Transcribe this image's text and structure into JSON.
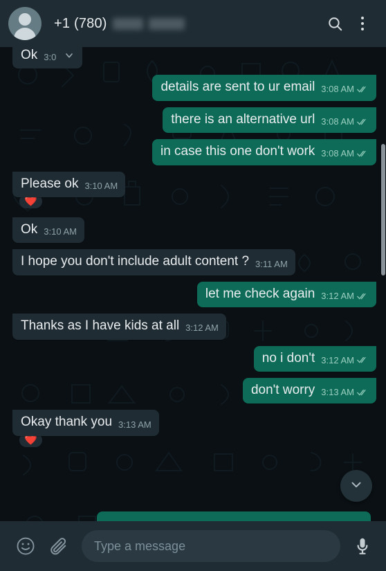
{
  "app": {
    "name": "WhatsApp",
    "theme": "dark"
  },
  "colors": {
    "header_bg": "#1f2c33",
    "chat_bg": "#0a1014",
    "incoming_bubble": "#202c33",
    "outgoing_bubble": "#0d6b57",
    "text_primary": "#e9edef",
    "timestamp": "#8fa3ab",
    "tick_blue": "#86c3b2",
    "input_bg": "#2a3942"
  },
  "header": {
    "contact_name": "+1 (780)",
    "name_redacted": true,
    "avatar": "default-person-avatar",
    "search_icon": "search-icon",
    "menu_icon": "overflow-menu-icon"
  },
  "messages": [
    {
      "id": 1,
      "direction": "in",
      "text": "Ok",
      "time": "3:0",
      "clipped": true,
      "has_dropdown_chevron": true,
      "ticks": false,
      "reaction": null
    },
    {
      "id": 2,
      "direction": "out",
      "text": "details are sent to ur email",
      "time": "3:08 AM",
      "ticks": true,
      "reaction": null
    },
    {
      "id": 3,
      "direction": "out",
      "text": "there is an alternative url",
      "time": "3:08 AM",
      "ticks": true,
      "reaction": null
    },
    {
      "id": 4,
      "direction": "out",
      "text": "in case this one don't work",
      "time": "3:08 AM",
      "ticks": true,
      "reaction": null
    },
    {
      "id": 5,
      "direction": "in",
      "text": "Please ok",
      "time": "3:10 AM",
      "ticks": false,
      "reaction": "❤️"
    },
    {
      "id": 6,
      "direction": "in",
      "text": "Ok",
      "time": "3:10 AM",
      "ticks": false,
      "reaction": null
    },
    {
      "id": 7,
      "direction": "in",
      "text": "I hope you don't include adult content ?",
      "time": "3:11 AM",
      "ticks": false,
      "reaction": null
    },
    {
      "id": 8,
      "direction": "out",
      "text": "let me check again",
      "time": "3:12 AM",
      "ticks": true,
      "reaction": null
    },
    {
      "id": 9,
      "direction": "in",
      "text": "Thanks as I have kids at all",
      "time": "3:12 AM",
      "ticks": false,
      "reaction": null
    },
    {
      "id": 10,
      "direction": "out",
      "text": "no i don't",
      "time": "3:12 AM",
      "ticks": true,
      "reaction": null
    },
    {
      "id": 11,
      "direction": "out",
      "text": "don't worry",
      "time": "3:13 AM",
      "ticks": true,
      "reaction": null
    },
    {
      "id": 12,
      "direction": "in",
      "text": "Okay thank you",
      "time": "3:13 AM",
      "ticks": false,
      "reaction": "❤️"
    }
  ],
  "scroll_to_bottom": {
    "icon": "chevron-down-icon"
  },
  "composer": {
    "emoji_icon": "emoji-smiley-icon",
    "attach_icon": "paperclip-icon",
    "mic_icon": "microphone-icon",
    "input_value": "",
    "placeholder": "Type a message"
  }
}
